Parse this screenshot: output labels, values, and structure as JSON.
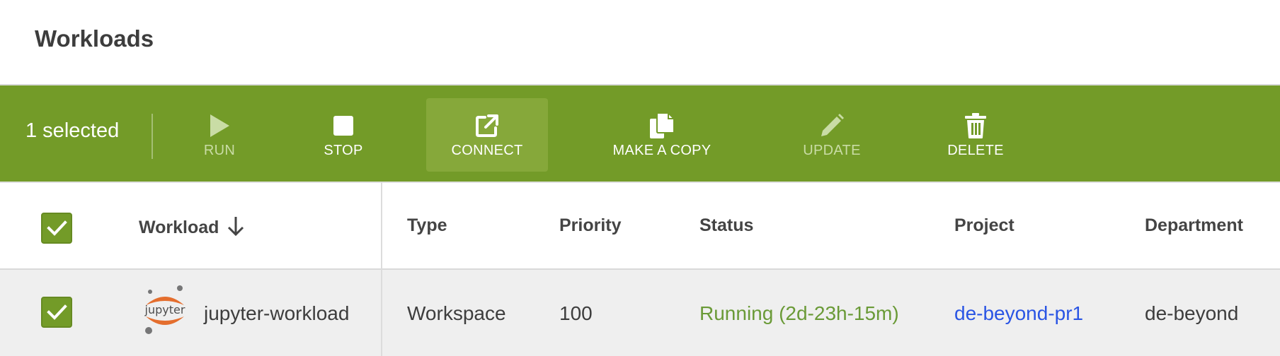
{
  "header": {
    "title": "Workloads"
  },
  "toolbar": {
    "selected_text": "1 selected",
    "buttons": [
      {
        "label": "RUN",
        "icon": "play-icon",
        "enabled": false
      },
      {
        "label": "STOP",
        "icon": "stop-icon",
        "enabled": true
      },
      {
        "label": "CONNECT",
        "icon": "external-link-icon",
        "enabled": true,
        "active": true
      },
      {
        "label": "MAKE A COPY",
        "icon": "copy-icon",
        "enabled": true
      },
      {
        "label": "UPDATE",
        "icon": "pencil-icon",
        "enabled": false
      },
      {
        "label": "DELETE",
        "icon": "trash-icon",
        "enabled": true
      }
    ]
  },
  "table": {
    "columns": [
      "Workload",
      "Type",
      "Priority",
      "Status",
      "Project",
      "Department"
    ],
    "sort": {
      "column": "Workload",
      "direction": "descending"
    },
    "header_checked": true,
    "rows": [
      {
        "checked": true,
        "logo_text": "jupyter",
        "workload": "jupyter-workload",
        "type": "Workspace",
        "priority": "100",
        "status": "Running (2d-23h-15m)",
        "project": "de-beyond-pr1",
        "department": "de-beyond"
      }
    ]
  },
  "colors": {
    "toolbar_bg": "#739b28",
    "status_running": "#6a9a37",
    "link": "#2a55e4",
    "checkbox": "#739b28"
  }
}
